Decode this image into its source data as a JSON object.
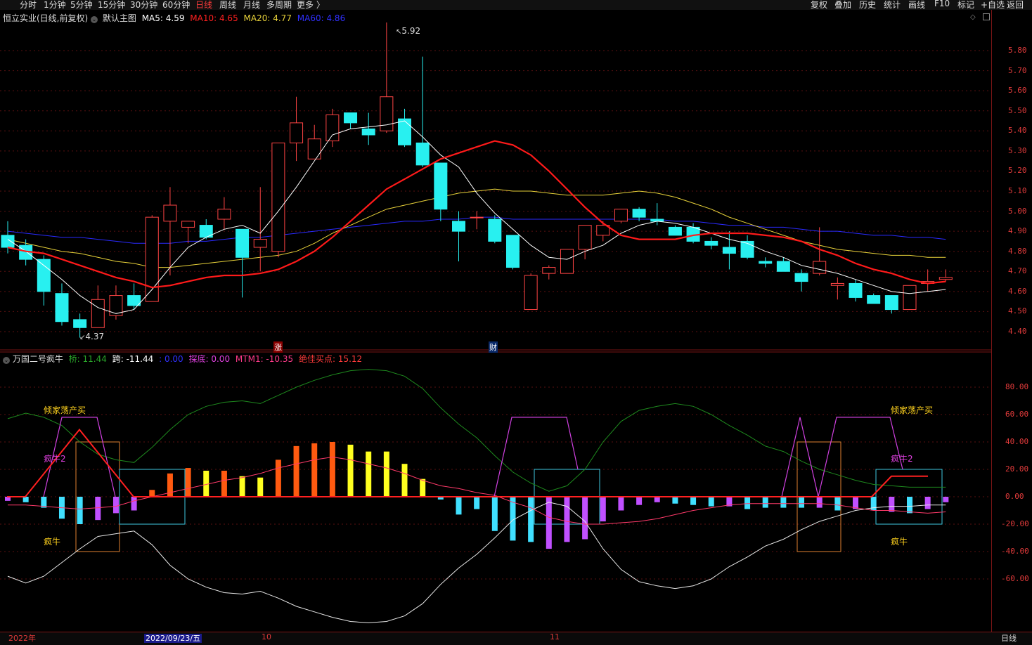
{
  "toolbar": {
    "periods": [
      "分时",
      "1分钟",
      "5分钟",
      "15分钟",
      "30分钟",
      "60分钟",
      "日线",
      "周线",
      "月线",
      "多周期",
      "更多 〉"
    ],
    "active": "日线",
    "right": [
      "复权",
      "叠加",
      "历史",
      "统计",
      "画线",
      "F10",
      "标记",
      "+自选",
      "返回"
    ]
  },
  "main_info": {
    "stock": "恒立实业(日线,前复权)",
    "template": "默认主图",
    "ma5": "MA5: 4.59",
    "ma10": "MA10: 4.65",
    "ma20": "MA20: 4.77",
    "ma60": "MA60: 4.86",
    "colors": {
      "ma5": "#ffffff",
      "ma10": "#ff2020",
      "ma20": "#e8d23a",
      "ma60": "#3030ff"
    }
  },
  "indicator_info": {
    "name": "万国二号疯牛",
    "qiao": "桥: 11.44",
    "kua": "跨: -11.44",
    "blank": ": 0.00",
    "tandi": "探底: 0.00",
    "mtm": "MTM1: -10.35",
    "jiajia": "绝佳买点: 15.12"
  },
  "annotations": {
    "high": "5.92",
    "low": "4.37",
    "zhang": "涨",
    "cai": "财",
    "qingjia_left": "倾家荡产买",
    "qingjia_right": "倾家荡产买",
    "fengniu2_left": "疯牛2",
    "fengniu2_right": "疯牛2",
    "fengniu_left": "疯牛",
    "fengniu_right": "疯牛"
  },
  "price_axis": [
    "5.80",
    "5.70",
    "5.60",
    "5.50",
    "5.40",
    "5.30",
    "5.20",
    "5.10",
    "5.00",
    "4.90",
    "4.80",
    "4.70",
    "4.60",
    "4.50",
    "4.40"
  ],
  "indicator_axis": [
    "80.00",
    "60.00",
    "40.00",
    "20.00",
    "0.00",
    "-20.00",
    "-40.00",
    "-60.00"
  ],
  "dates": {
    "d1": "2022年",
    "d2": "2022/09/23/五",
    "d3": "10",
    "d4": "11"
  },
  "period_label": "日线",
  "chart_data": {
    "type": "candlestick",
    "ylim": [
      4.33,
      5.97
    ],
    "candles": [
      {
        "o": 4.88,
        "c": 4.82,
        "h": 4.95,
        "l": 4.79
      },
      {
        "o": 4.83,
        "c": 4.76,
        "h": 4.86,
        "l": 4.73
      },
      {
        "o": 4.76,
        "c": 4.6,
        "h": 4.78,
        "l": 4.53
      },
      {
        "o": 4.59,
        "c": 4.45,
        "h": 4.64,
        "l": 4.43
      },
      {
        "o": 4.46,
        "c": 4.42,
        "h": 4.49,
        "l": 4.37
      },
      {
        "o": 4.42,
        "c": 4.56,
        "h": 4.63,
        "l": 4.42
      },
      {
        "o": 4.48,
        "c": 4.58,
        "h": 4.63,
        "l": 4.46
      },
      {
        "o": 4.58,
        "c": 4.53,
        "h": 4.64,
        "l": 4.51
      },
      {
        "o": 4.55,
        "c": 4.97,
        "h": 4.98,
        "l": 4.55
      },
      {
        "o": 4.95,
        "c": 5.03,
        "h": 5.12,
        "l": 4.68
      },
      {
        "o": 4.92,
        "c": 4.95,
        "h": 4.95,
        "l": 4.84
      },
      {
        "o": 4.93,
        "c": 4.87,
        "h": 4.96,
        "l": 4.86
      },
      {
        "o": 4.96,
        "c": 5.01,
        "h": 5.07,
        "l": 4.91
      },
      {
        "o": 4.91,
        "c": 4.77,
        "h": 4.91,
        "l": 4.57
      },
      {
        "o": 4.82,
        "c": 4.86,
        "h": 5.12,
        "l": 4.7
      },
      {
        "o": 4.8,
        "c": 5.34,
        "h": 5.34,
        "l": 4.77
      },
      {
        "o": 5.34,
        "c": 5.44,
        "h": 5.57,
        "l": 5.25
      },
      {
        "o": 5.26,
        "c": 5.36,
        "h": 5.43,
        "l": 5.26
      },
      {
        "o": 5.35,
        "c": 5.48,
        "h": 5.51,
        "l": 5.32
      },
      {
        "o": 5.49,
        "c": 5.44,
        "h": 5.49,
        "l": 5.41
      },
      {
        "o": 5.41,
        "c": 5.38,
        "h": 5.49,
        "l": 5.33
      },
      {
        "o": 5.4,
        "c": 5.57,
        "h": 5.94,
        "l": 5.39
      },
      {
        "o": 5.46,
        "c": 5.33,
        "h": 5.51,
        "l": 5.32
      },
      {
        "o": 5.34,
        "c": 5.23,
        "h": 5.77,
        "l": 5.22
      },
      {
        "o": 5.24,
        "c": 5.01,
        "h": 5.24,
        "l": 4.95
      },
      {
        "o": 4.95,
        "c": 4.9,
        "h": 5.0,
        "l": 4.75
      },
      {
        "o": 4.97,
        "c": 4.97,
        "h": 5.0,
        "l": 4.91
      },
      {
        "o": 4.96,
        "c": 4.85,
        "h": 4.98,
        "l": 4.84
      },
      {
        "o": 4.88,
        "c": 4.72,
        "h": 4.88,
        "l": 4.71
      },
      {
        "o": 4.51,
        "c": 4.68,
        "h": 4.69,
        "l": 4.51
      },
      {
        "o": 4.69,
        "c": 4.72,
        "h": 4.73,
        "l": 4.66
      },
      {
        "o": 4.69,
        "c": 4.81,
        "h": 4.81,
        "l": 4.69
      },
      {
        "o": 4.81,
        "c": 4.93,
        "h": 4.93,
        "l": 4.76
      },
      {
        "o": 4.88,
        "c": 4.93,
        "h": 4.95,
        "l": 4.85
      },
      {
        "o": 4.95,
        "c": 5.01,
        "h": 5.01,
        "l": 4.94
      },
      {
        "o": 5.01,
        "c": 4.97,
        "h": 5.02,
        "l": 4.95
      },
      {
        "o": 4.96,
        "c": 4.95,
        "h": 5.04,
        "l": 4.93
      },
      {
        "o": 4.92,
        "c": 4.88,
        "h": 4.93,
        "l": 4.88
      },
      {
        "o": 4.92,
        "c": 4.85,
        "h": 4.94,
        "l": 4.84
      },
      {
        "o": 4.85,
        "c": 4.83,
        "h": 4.87,
        "l": 4.81
      },
      {
        "o": 4.82,
        "c": 4.79,
        "h": 4.9,
        "l": 4.71
      },
      {
        "o": 4.85,
        "c": 4.77,
        "h": 4.88,
        "l": 4.76
      },
      {
        "o": 4.75,
        "c": 4.74,
        "h": 4.77,
        "l": 4.72
      },
      {
        "o": 4.75,
        "c": 4.7,
        "h": 4.77,
        "l": 4.7
      },
      {
        "o": 4.69,
        "c": 4.65,
        "h": 4.71,
        "l": 4.6
      },
      {
        "o": 4.69,
        "c": 4.75,
        "h": 4.92,
        "l": 4.68
      },
      {
        "o": 4.63,
        "c": 4.64,
        "h": 4.67,
        "l": 4.56
      },
      {
        "o": 4.64,
        "c": 4.57,
        "h": 4.66,
        "l": 4.55
      },
      {
        "o": 4.58,
        "c": 4.54,
        "h": 4.59,
        "l": 4.54
      },
      {
        "o": 4.58,
        "c": 4.51,
        "h": 4.58,
        "l": 4.49
      },
      {
        "o": 4.51,
        "c": 4.63,
        "h": 4.63,
        "l": 4.51
      },
      {
        "o": 4.64,
        "c": 4.65,
        "h": 4.71,
        "l": 4.6
      },
      {
        "o": 4.66,
        "c": 4.67,
        "h": 4.71,
        "l": 4.65
      }
    ],
    "ma5": [
      4.86,
      4.8,
      4.73,
      4.66,
      4.58,
      4.52,
      4.49,
      4.51,
      4.61,
      4.72,
      4.82,
      4.87,
      4.91,
      4.93,
      4.89,
      5.0,
      5.12,
      5.25,
      5.38,
      5.41,
      5.42,
      5.43,
      5.45,
      5.37,
      5.28,
      5.22,
      5.09,
      4.99,
      4.91,
      4.83,
      4.77,
      4.76,
      4.8,
      4.83,
      4.89,
      4.93,
      4.95,
      4.94,
      4.92,
      4.89,
      4.86,
      4.84,
      4.8,
      4.77,
      4.73,
      4.71,
      4.69,
      4.66,
      4.63,
      4.6,
      4.59,
      4.6,
      4.61
    ],
    "ma10": [
      4.82,
      4.8,
      4.79,
      4.76,
      4.73,
      4.7,
      4.67,
      4.65,
      4.62,
      4.63,
      4.65,
      4.67,
      4.68,
      4.68,
      4.69,
      4.71,
      4.75,
      4.8,
      4.87,
      4.95,
      5.03,
      5.11,
      5.16,
      5.21,
      5.26,
      5.29,
      5.32,
      5.35,
      5.33,
      5.28,
      5.2,
      5.11,
      5.02,
      4.94,
      4.88,
      4.86,
      4.86,
      4.86,
      4.88,
      4.89,
      4.89,
      4.89,
      4.88,
      4.87,
      4.85,
      4.81,
      4.78,
      4.74,
      4.71,
      4.69,
      4.66,
      4.64,
      4.65
    ],
    "ma20": [
      4.86,
      4.84,
      4.82,
      4.8,
      4.79,
      4.77,
      4.75,
      4.74,
      4.72,
      4.72,
      4.73,
      4.74,
      4.75,
      4.76,
      4.77,
      4.78,
      4.8,
      4.84,
      4.89,
      4.93,
      4.97,
      5.01,
      5.03,
      5.05,
      5.07,
      5.09,
      5.1,
      5.11,
      5.1,
      5.1,
      5.09,
      5.08,
      5.08,
      5.08,
      5.09,
      5.1,
      5.09,
      5.07,
      5.04,
      5.01,
      4.97,
      4.94,
      4.91,
      4.88,
      4.85,
      4.83,
      4.81,
      4.8,
      4.79,
      4.78,
      4.78,
      4.77,
      4.77
    ],
    "ma60": [
      4.9,
      4.89,
      4.88,
      4.87,
      4.87,
      4.86,
      4.85,
      4.84,
      4.84,
      4.84,
      4.85,
      4.85,
      4.86,
      4.87,
      4.87,
      4.88,
      4.89,
      4.9,
      4.91,
      4.92,
      4.93,
      4.94,
      4.95,
      4.95,
      4.96,
      4.96,
      4.97,
      4.97,
      4.96,
      4.96,
      4.96,
      4.96,
      4.96,
      4.96,
      4.96,
      4.96,
      4.96,
      4.95,
      4.95,
      4.94,
      4.93,
      4.93,
      4.92,
      4.92,
      4.91,
      4.9,
      4.9,
      4.89,
      4.88,
      4.88,
      4.87,
      4.87,
      4.86
    ],
    "indicator": {
      "ylim": [
        -95,
        95
      ],
      "bars": [
        -3,
        -4,
        -8,
        -16,
        -20,
        -17,
        -12,
        -10,
        5,
        17,
        21,
        19,
        19,
        15,
        14,
        27,
        37,
        39,
        40,
        38,
        33,
        33,
        24,
        13,
        -2,
        -13,
        -9,
        -25,
        -32,
        -33,
        -38,
        -33,
        -31,
        -18,
        -10,
        -6,
        -4,
        -5,
        -6,
        -7,
        -7,
        -9,
        -8,
        -8,
        -8,
        -8,
        -10,
        -9,
        -10,
        -11,
        -12,
        -9,
        -4
      ],
      "bar_colors": [
        "#c050ff",
        "#40e0ff",
        "#40e0ff",
        "#40e0ff",
        "#40e0ff",
        "#c050ff",
        "#c050ff",
        "#c050ff",
        "#ff5a10",
        "#ff5a10",
        "#ff5a10",
        "#ffff20",
        "#ff5a10",
        "#ffff20",
        "#ffff20",
        "#ff5a10",
        "#ff5a10",
        "#ff5a10",
        "#ff5a10",
        "#ffff20",
        "#ffff20",
        "#ffff20",
        "#ffff20",
        "#ffff20",
        "#40e0ff",
        "#40e0ff",
        "#40e0ff",
        "#40e0ff",
        "#40e0ff",
        "#40e0ff",
        "#c050ff",
        "#c050ff",
        "#c050ff",
        "#c050ff",
        "#c050ff",
        "#c050ff",
        "#c050ff",
        "#40e0ff",
        "#40e0ff",
        "#40e0ff",
        "#c050ff",
        "#40e0ff",
        "#40e0ff",
        "#40e0ff",
        "#40e0ff",
        "#c050ff",
        "#40e0ff",
        "#c050ff",
        "#40e0ff",
        "#c050ff",
        "#40e0ff",
        "#c050ff",
        "#c050ff"
      ],
      "green": [
        57,
        61,
        58,
        52,
        40,
        31,
        27,
        25,
        36,
        49,
        60,
        66,
        69,
        70,
        68,
        74,
        80,
        85,
        89,
        92,
        93,
        92,
        88,
        79,
        65,
        53,
        43,
        30,
        18,
        10,
        4,
        8,
        20,
        40,
        55,
        63,
        66,
        68,
        66,
        60,
        52,
        45,
        37,
        33,
        26,
        20,
        16,
        12,
        9,
        8,
        7,
        7,
        7
      ],
      "white": [
        -58,
        -63,
        -58,
        -48,
        -38,
        -29,
        -27,
        -25,
        -35,
        -50,
        -60,
        -66,
        -70,
        -71,
        -69,
        -74,
        -80,
        -84,
        -88,
        -91,
        -92,
        -91,
        -87,
        -78,
        -64,
        -52,
        -42,
        -30,
        -17,
        -10,
        -4,
        -7,
        -18,
        -38,
        -53,
        -62,
        -65,
        -67,
        -65,
        -60,
        -51,
        -44,
        -36,
        -31,
        -24,
        -18,
        -14,
        -10,
        -8,
        -7,
        -7,
        -6,
        -6
      ],
      "pink": [
        -6,
        -6,
        -7,
        -8,
        -9,
        -8,
        -7,
        -3,
        0,
        3,
        6,
        9,
        12,
        14,
        17,
        21,
        24,
        27,
        29,
        27,
        24,
        21,
        17,
        12,
        8,
        6,
        3,
        1,
        -4,
        -8,
        -15,
        -18,
        -20,
        -20,
        -19,
        -18,
        -16,
        -13,
        -10,
        -8,
        -6,
        -5,
        -5,
        -5,
        -5,
        -5,
        -6,
        -8,
        -10,
        -10,
        -11,
        -12,
        -11
      ]
    }
  }
}
